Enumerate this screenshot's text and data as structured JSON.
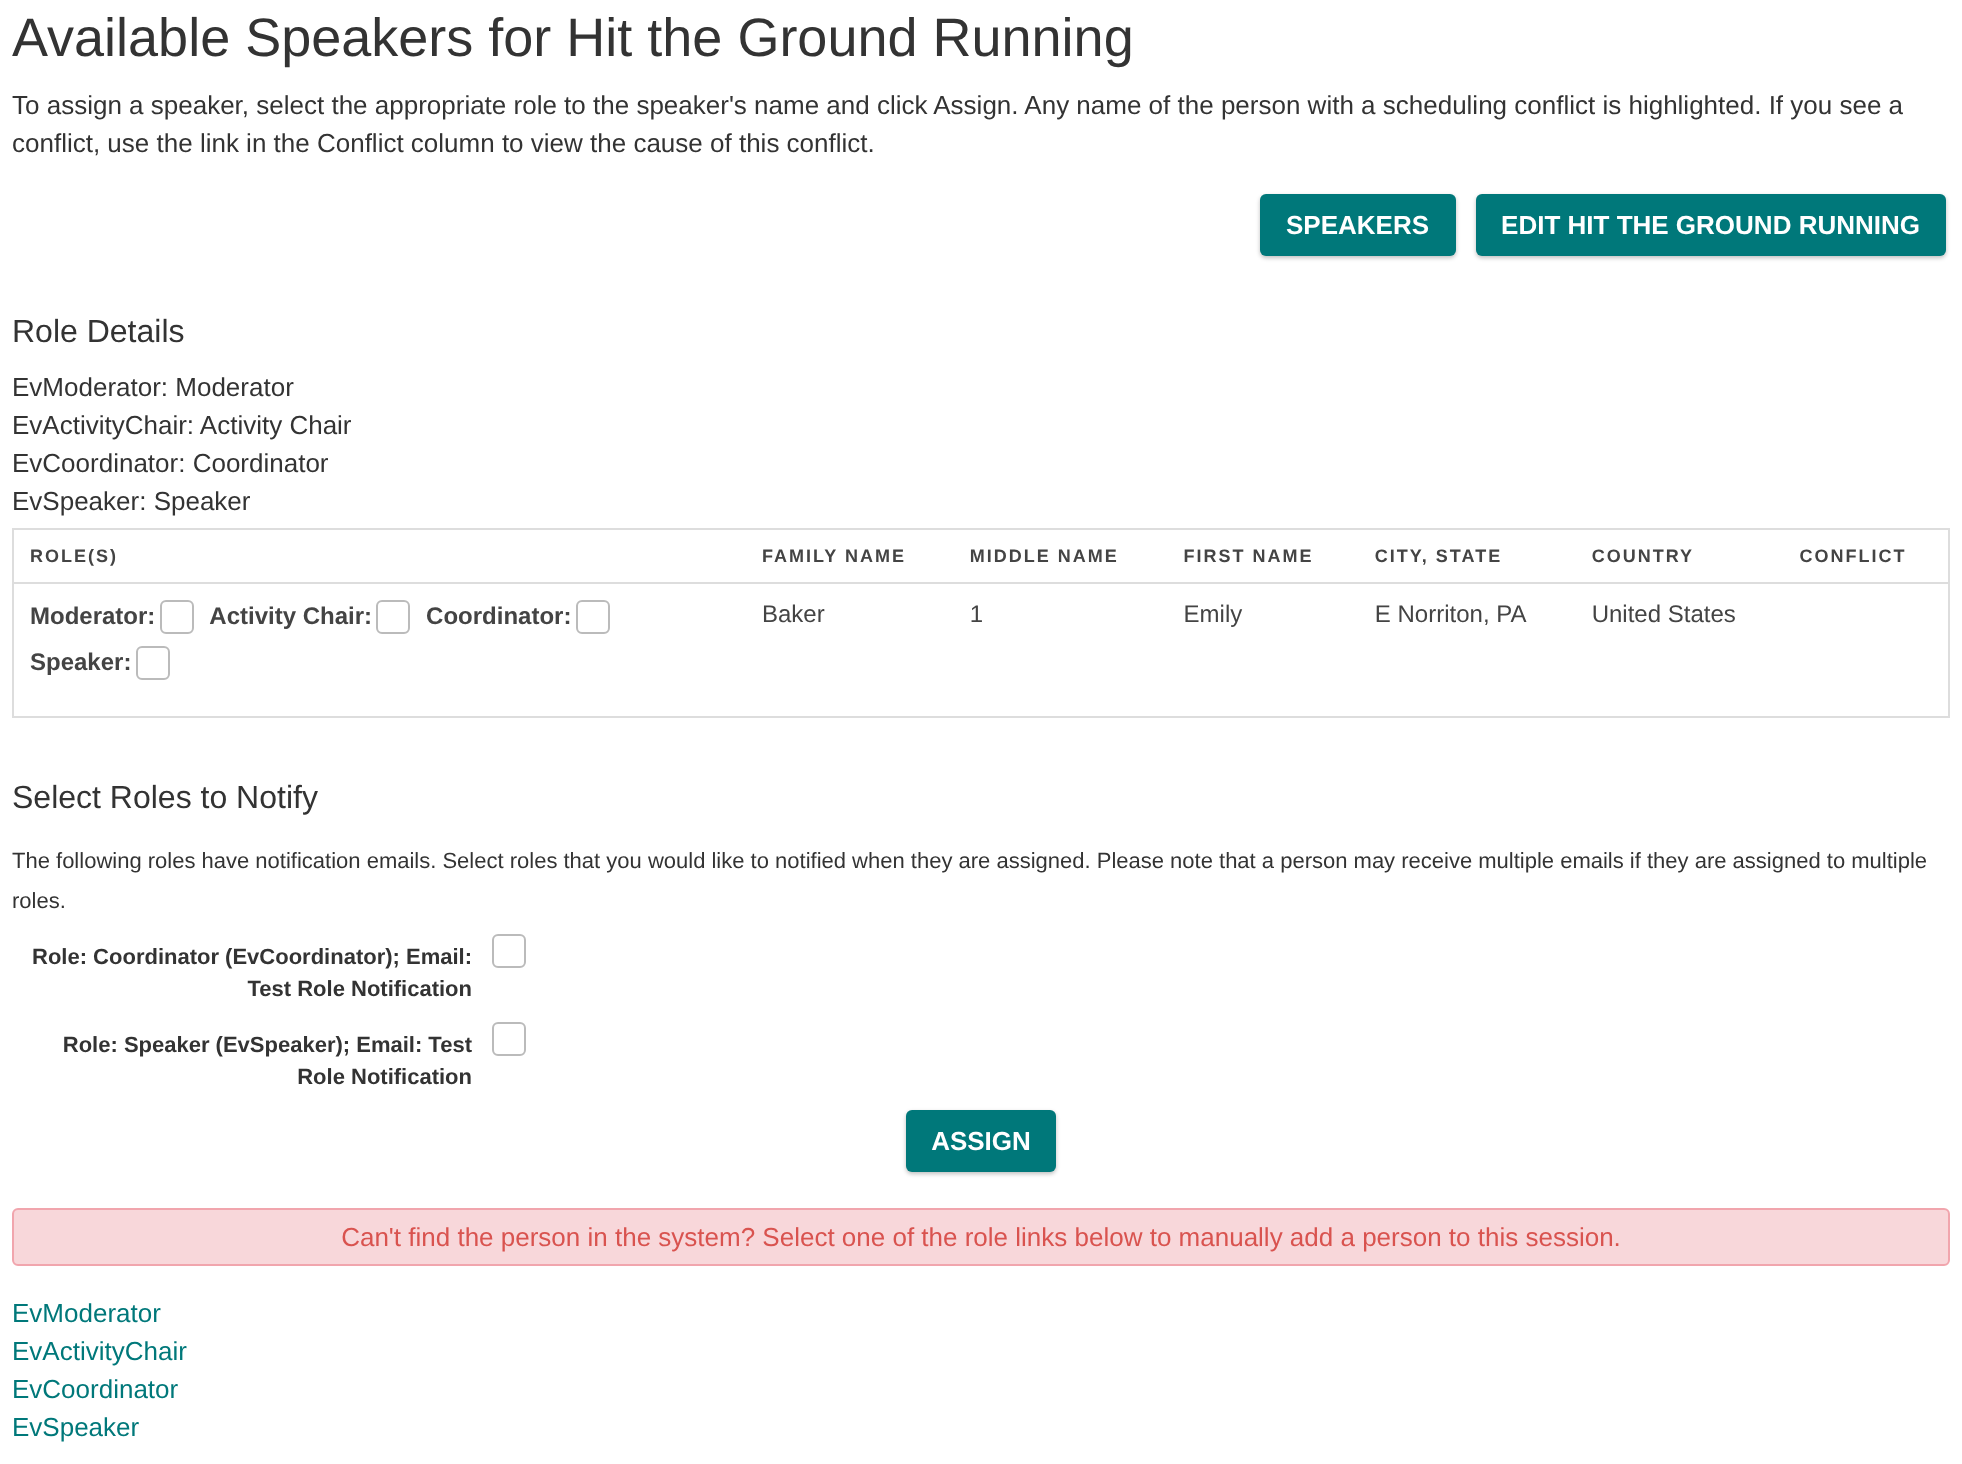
{
  "title": "Available Speakers for Hit the Ground Running",
  "intro": "To assign a speaker, select the appropriate role to the speaker's name and click Assign. Any name of the person with a scheduling conflict is highlighted. If you see a conflict, use the link in the Conflict column to view the cause of this conflict.",
  "top_buttons": [
    "SPEAKERS",
    "EDIT HIT THE GROUND RUNNING"
  ],
  "role_details": {
    "heading": "Role Details",
    "lines": [
      "EvModerator: Moderator",
      "EvActivityChair: Activity Chair",
      "EvCoordinator: Coordinator",
      "EvSpeaker: Speaker"
    ]
  },
  "table": {
    "columns": [
      "ROLE(S)",
      "FAMILY NAME",
      "MIDDLE NAME",
      "FIRST NAME",
      "CITY, STATE",
      "COUNTRY",
      "CONFLICT"
    ],
    "rows": [
      {
        "cells": [
          {
            "kind": "role_checkboxes",
            "roles": [
              {
                "label": "Moderator:",
                "checked": false
              },
              {
                "label": "Activity Chair:",
                "checked": false
              },
              {
                "label": "Coordinator:",
                "checked": false
              },
              {
                "label": "Speaker:",
                "checked": false
              }
            ]
          },
          "Baker",
          "1",
          "Emily",
          "E Norriton, PA",
          "United States"
        ]
      }
    ]
  },
  "notify": {
    "heading": "Select Roles to Notify",
    "description": "The following roles have notification emails. Select roles that you would like to notified when they are assigned. Please note that a person may receive multiple emails if they are assigned to multiple roles.",
    "options": [
      {
        "label": "Role: Coordinator (EvCoordinator); Email: Test Role Notification",
        "checked": false
      },
      {
        "label": "Role: Speaker (EvSpeaker); Email: Test Role Notification",
        "checked": false
      }
    ]
  },
  "assign_button": "ASSIGN",
  "alert": "Can't find the person in the system? Select one of the role links below to manually add a person to this session.",
  "role_links": [
    "EvModerator",
    "EvActivityChair",
    "EvCoordinator",
    "EvSpeaker"
  ]
}
